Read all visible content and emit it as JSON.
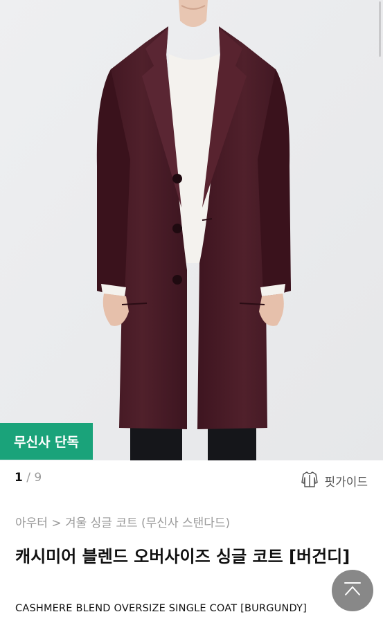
{
  "hero": {
    "badge": "무신사 단독",
    "pagination": {
      "current": "1",
      "separator": "/",
      "total": "9"
    }
  },
  "fit_guide": {
    "label": "핏가이드",
    "icon": "coat-outline-icon"
  },
  "breadcrumb": {
    "category": "아우터",
    "separator": ">",
    "subcategory": "겨울 싱글 코트 (무신사 스탠다드)"
  },
  "product": {
    "title_ko": "캐시미어 블렌드 오버사이즈 싱글 코트 [버건디]",
    "title_en": "CASHMERE BLEND OVERSIZE SINGLE COAT [BURGUNDY]"
  },
  "scroll_top": {
    "icon": "chevron-up-icon"
  },
  "colors": {
    "badge": "#1aa37a",
    "coat": "#4a1c26",
    "background": "#ecedef"
  }
}
